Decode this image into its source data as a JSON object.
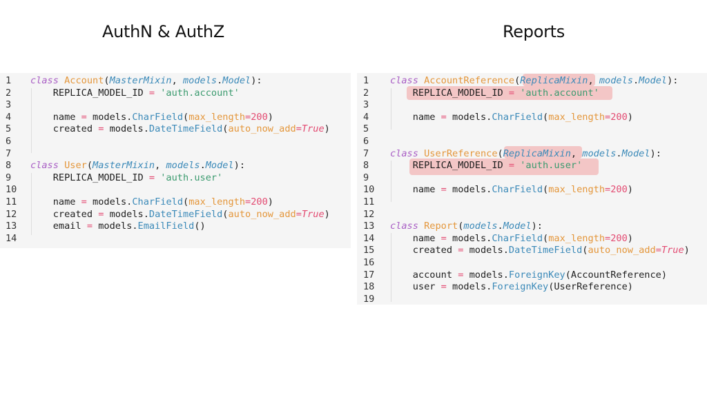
{
  "titles": {
    "left": "AuthN & AuthZ",
    "right": "Reports"
  },
  "left_panel": {
    "lines": [
      {
        "n": "1",
        "tokens": [
          {
            "t": "class ",
            "c": "kw"
          },
          {
            "t": "Account",
            "c": "cls"
          },
          {
            "t": "(",
            "c": "plain"
          },
          {
            "t": "MasterMixin",
            "c": "base"
          },
          {
            "t": ", ",
            "c": "plain"
          },
          {
            "t": "models",
            "c": "base"
          },
          {
            "t": ".",
            "c": "plain"
          },
          {
            "t": "Model",
            "c": "base"
          },
          {
            "t": "):",
            "c": "plain"
          }
        ]
      },
      {
        "n": "2",
        "tokens": [
          {
            "t": "    REPLICA_MODEL_ID ",
            "c": "plain"
          },
          {
            "t": "=",
            "c": "op"
          },
          {
            "t": " ",
            "c": "plain"
          },
          {
            "t": "'auth.account'",
            "c": "str"
          }
        ]
      },
      {
        "n": "3",
        "tokens": []
      },
      {
        "n": "4",
        "tokens": [
          {
            "t": "    name ",
            "c": "plain"
          },
          {
            "t": "=",
            "c": "op"
          },
          {
            "t": " models.",
            "c": "plain"
          },
          {
            "t": "CharField",
            "c": "attr"
          },
          {
            "t": "(",
            "c": "plain"
          },
          {
            "t": "max_length",
            "c": "arg"
          },
          {
            "t": "=",
            "c": "op"
          },
          {
            "t": "200",
            "c": "num"
          },
          {
            "t": ")",
            "c": "plain"
          }
        ]
      },
      {
        "n": "5",
        "tokens": [
          {
            "t": "    created ",
            "c": "plain"
          },
          {
            "t": "=",
            "c": "op"
          },
          {
            "t": " models.",
            "c": "plain"
          },
          {
            "t": "DateTimeField",
            "c": "attr"
          },
          {
            "t": "(",
            "c": "plain"
          },
          {
            "t": "auto_now_add",
            "c": "arg"
          },
          {
            "t": "=",
            "c": "op"
          },
          {
            "t": "True",
            "c": "true"
          },
          {
            "t": ")",
            "c": "plain"
          }
        ]
      },
      {
        "n": "6",
        "tokens": []
      },
      {
        "n": "7",
        "tokens": []
      },
      {
        "n": "8",
        "tokens": [
          {
            "t": "class ",
            "c": "kw"
          },
          {
            "t": "User",
            "c": "cls"
          },
          {
            "t": "(",
            "c": "plain"
          },
          {
            "t": "MasterMixin",
            "c": "base"
          },
          {
            "t": ", ",
            "c": "plain"
          },
          {
            "t": "models",
            "c": "base"
          },
          {
            "t": ".",
            "c": "plain"
          },
          {
            "t": "Model",
            "c": "base"
          },
          {
            "t": "):",
            "c": "plain"
          }
        ]
      },
      {
        "n": "9",
        "tokens": [
          {
            "t": "    REPLICA_MODEL_ID ",
            "c": "plain"
          },
          {
            "t": "=",
            "c": "op"
          },
          {
            "t": " ",
            "c": "plain"
          },
          {
            "t": "'auth.user'",
            "c": "str"
          }
        ]
      },
      {
        "n": "10",
        "tokens": []
      },
      {
        "n": "11",
        "tokens": [
          {
            "t": "    name ",
            "c": "plain"
          },
          {
            "t": "=",
            "c": "op"
          },
          {
            "t": " models.",
            "c": "plain"
          },
          {
            "t": "CharField",
            "c": "attr"
          },
          {
            "t": "(",
            "c": "plain"
          },
          {
            "t": "max_length",
            "c": "arg"
          },
          {
            "t": "=",
            "c": "op"
          },
          {
            "t": "200",
            "c": "num"
          },
          {
            "t": ")",
            "c": "plain"
          }
        ]
      },
      {
        "n": "12",
        "tokens": [
          {
            "t": "    created ",
            "c": "plain"
          },
          {
            "t": "=",
            "c": "op"
          },
          {
            "t": " models.",
            "c": "plain"
          },
          {
            "t": "DateTimeField",
            "c": "attr"
          },
          {
            "t": "(",
            "c": "plain"
          },
          {
            "t": "auto_now_add",
            "c": "arg"
          },
          {
            "t": "=",
            "c": "op"
          },
          {
            "t": "True",
            "c": "true"
          },
          {
            "t": ")",
            "c": "plain"
          }
        ]
      },
      {
        "n": "13",
        "tokens": [
          {
            "t": "    email ",
            "c": "plain"
          },
          {
            "t": "=",
            "c": "op"
          },
          {
            "t": " models.",
            "c": "plain"
          },
          {
            "t": "EmailField",
            "c": "attr"
          },
          {
            "t": "()",
            "c": "plain"
          }
        ]
      },
      {
        "n": "14",
        "tokens": []
      }
    ]
  },
  "right_panel": {
    "lines": [
      {
        "n": "1",
        "tokens": [
          {
            "t": "class ",
            "c": "kw"
          },
          {
            "t": "AccountReference",
            "c": "cls"
          },
          {
            "t": "(",
            "c": "plain"
          },
          {
            "t": "ReplicaMixin",
            "c": "base"
          },
          {
            "t": ", ",
            "c": "plain"
          },
          {
            "t": "models",
            "c": "base"
          },
          {
            "t": ".",
            "c": "plain"
          },
          {
            "t": "Model",
            "c": "base"
          },
          {
            "t": "):",
            "c": "plain"
          }
        ]
      },
      {
        "n": "2",
        "tokens": [
          {
            "t": "    REPLICA_MODEL_ID ",
            "c": "plain"
          },
          {
            "t": "=",
            "c": "op"
          },
          {
            "t": " ",
            "c": "plain"
          },
          {
            "t": "'auth.account'",
            "c": "str"
          }
        ]
      },
      {
        "n": "3",
        "tokens": []
      },
      {
        "n": "4",
        "tokens": [
          {
            "t": "    name ",
            "c": "plain"
          },
          {
            "t": "=",
            "c": "op"
          },
          {
            "t": " models.",
            "c": "plain"
          },
          {
            "t": "CharField",
            "c": "attr"
          },
          {
            "t": "(",
            "c": "plain"
          },
          {
            "t": "max_length",
            "c": "arg"
          },
          {
            "t": "=",
            "c": "op"
          },
          {
            "t": "200",
            "c": "num"
          },
          {
            "t": ")",
            "c": "plain"
          }
        ]
      },
      {
        "n": "5",
        "tokens": []
      },
      {
        "n": "6",
        "tokens": []
      },
      {
        "n": "7",
        "tokens": [
          {
            "t": "class ",
            "c": "kw"
          },
          {
            "t": "UserReference",
            "c": "cls"
          },
          {
            "t": "(",
            "c": "plain"
          },
          {
            "t": "ReplicaMixin",
            "c": "base"
          },
          {
            "t": ", ",
            "c": "plain"
          },
          {
            "t": "models",
            "c": "base"
          },
          {
            "t": ".",
            "c": "plain"
          },
          {
            "t": "Model",
            "c": "base"
          },
          {
            "t": "):",
            "c": "plain"
          }
        ]
      },
      {
        "n": "8",
        "tokens": [
          {
            "t": "    REPLICA_MODEL_ID ",
            "c": "plain"
          },
          {
            "t": "=",
            "c": "op"
          },
          {
            "t": " ",
            "c": "plain"
          },
          {
            "t": "'auth.user'",
            "c": "str"
          }
        ]
      },
      {
        "n": "9",
        "tokens": []
      },
      {
        "n": "10",
        "tokens": [
          {
            "t": "    name ",
            "c": "plain"
          },
          {
            "t": "=",
            "c": "op"
          },
          {
            "t": " models.",
            "c": "plain"
          },
          {
            "t": "CharField",
            "c": "attr"
          },
          {
            "t": "(",
            "c": "plain"
          },
          {
            "t": "max_length",
            "c": "arg"
          },
          {
            "t": "=",
            "c": "op"
          },
          {
            "t": "200",
            "c": "num"
          },
          {
            "t": ")",
            "c": "plain"
          }
        ]
      },
      {
        "n": "11",
        "tokens": []
      },
      {
        "n": "12",
        "tokens": []
      },
      {
        "n": "13",
        "tokens": [
          {
            "t": "class ",
            "c": "kw"
          },
          {
            "t": "Report",
            "c": "cls"
          },
          {
            "t": "(",
            "c": "plain"
          },
          {
            "t": "models",
            "c": "base"
          },
          {
            "t": ".",
            "c": "plain"
          },
          {
            "t": "Model",
            "c": "base"
          },
          {
            "t": "):",
            "c": "plain"
          }
        ]
      },
      {
        "n": "14",
        "tokens": [
          {
            "t": "    name ",
            "c": "plain"
          },
          {
            "t": "=",
            "c": "op"
          },
          {
            "t": " models.",
            "c": "plain"
          },
          {
            "t": "CharField",
            "c": "attr"
          },
          {
            "t": "(",
            "c": "plain"
          },
          {
            "t": "max_length",
            "c": "arg"
          },
          {
            "t": "=",
            "c": "op"
          },
          {
            "t": "200",
            "c": "num"
          },
          {
            "t": ")",
            "c": "plain"
          }
        ]
      },
      {
        "n": "15",
        "tokens": [
          {
            "t": "    created ",
            "c": "plain"
          },
          {
            "t": "=",
            "c": "op"
          },
          {
            "t": " models.",
            "c": "plain"
          },
          {
            "t": "DateTimeField",
            "c": "attr"
          },
          {
            "t": "(",
            "c": "plain"
          },
          {
            "t": "auto_now_add",
            "c": "arg"
          },
          {
            "t": "=",
            "c": "op"
          },
          {
            "t": "True",
            "c": "true"
          },
          {
            "t": ")",
            "c": "plain"
          }
        ]
      },
      {
        "n": "16",
        "tokens": []
      },
      {
        "n": "17",
        "tokens": [
          {
            "t": "    account ",
            "c": "plain"
          },
          {
            "t": "=",
            "c": "op"
          },
          {
            "t": " models.",
            "c": "plain"
          },
          {
            "t": "ForeignKey",
            "c": "attr"
          },
          {
            "t": "(AccountReference)",
            "c": "plain"
          }
        ]
      },
      {
        "n": "18",
        "tokens": [
          {
            "t": "    user ",
            "c": "plain"
          },
          {
            "t": "=",
            "c": "op"
          },
          {
            "t": " models.",
            "c": "plain"
          },
          {
            "t": "ForeignKey",
            "c": "attr"
          },
          {
            "t": "(UserReference)",
            "c": "plain"
          }
        ]
      },
      {
        "n": "19",
        "tokens": []
      }
    ]
  },
  "colors": {
    "keyword": "#a85dc4",
    "class_name": "#e4963a",
    "base_class": "#3a89b8",
    "string": "#3a9a6e",
    "operator": "#e34b72",
    "highlight": "#f07878"
  }
}
